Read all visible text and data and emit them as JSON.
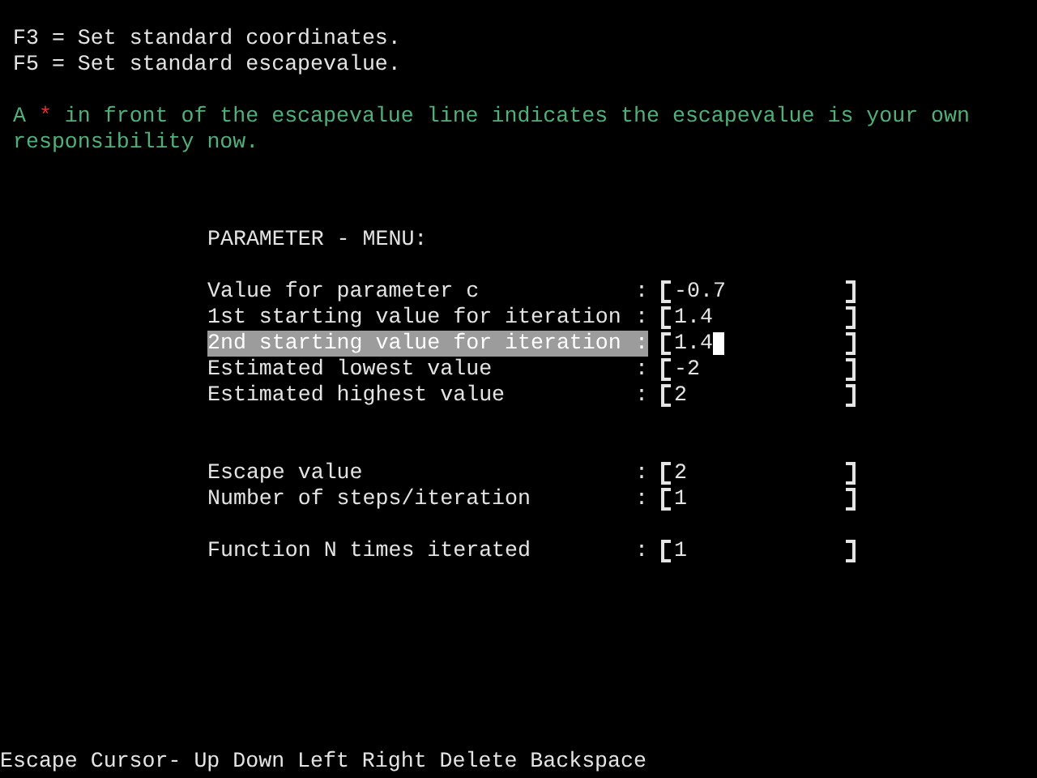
{
  "help_lines": [
    "F3 = Set standard coordinates.",
    "F5 = Set standard escapevalue."
  ],
  "note": [
    {
      "kind": "text",
      "text": "A "
    },
    {
      "kind": "marker",
      "text": "*"
    },
    {
      "kind": "text",
      "text": " in front of the escapevalue line indicates the escapevalue is your own responsibility now."
    }
  ],
  "menu": {
    "title": "PARAMETER - MENU:",
    "groups": [
      [
        {
          "label": "Value for parameter c",
          "separator": ":",
          "value": "-0.7",
          "selected": false
        },
        {
          "label": "1st starting value for iteration",
          "separator": ":",
          "value": "1.4",
          "selected": false
        },
        {
          "label": "2nd starting value for iteration",
          "separator": ":",
          "value": "1.4",
          "selected": true
        },
        {
          "label": "Estimated lowest value",
          "separator": ":",
          "value": "-2",
          "selected": false
        },
        {
          "label": "Estimated highest value",
          "separator": ":",
          "value": "2",
          "selected": false
        }
      ],
      [
        {
          "label": "Escape value",
          "separator": ":",
          "value": "2",
          "selected": false
        },
        {
          "label": "Number of steps/iteration",
          "separator": ":",
          "value": "1",
          "selected": false
        }
      ],
      [
        {
          "label": "Function N times iterated",
          "separator": ":",
          "value": "1",
          "selected": false
        }
      ]
    ]
  },
  "status_bar": "Escape Cursor- Up Down Left Right Delete Backspace"
}
